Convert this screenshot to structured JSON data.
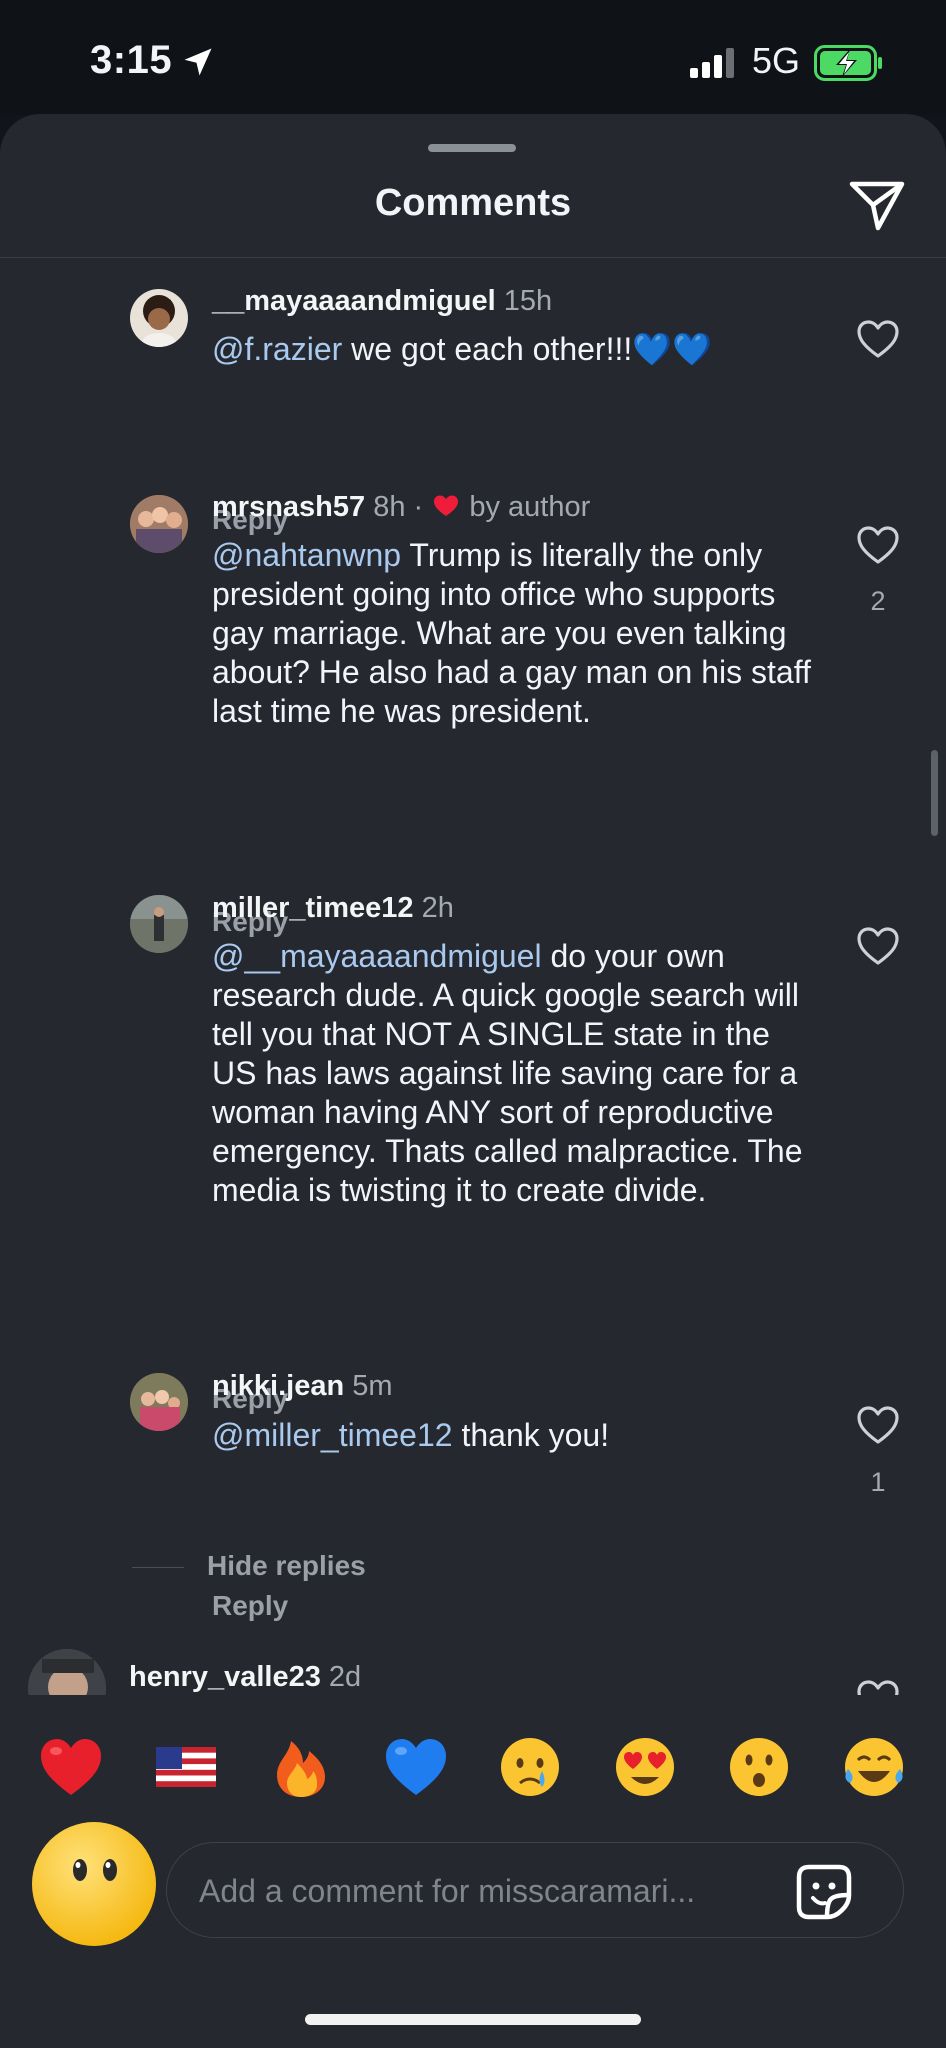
{
  "status_bar": {
    "time": "3:15",
    "network": "5G"
  },
  "header": {
    "title": "Comments"
  },
  "comments": [
    {
      "username": "__mayaaaandmiguel",
      "time": "15h",
      "mention": "@f.razier",
      "text": " we got each other!!!💙💙",
      "reply": "Reply"
    },
    {
      "username": "mrsnash57",
      "time": "8h",
      "separator": "·",
      "liked_by_author": "by author",
      "mention": "@nahtanwnp",
      "text": " Trump is literally the only president going into office who supports gay marriage. What are you even talking about? He also had a gay man on his staff last time he was president.",
      "reply": "Reply",
      "likes": "2"
    },
    {
      "username": "miller_timee12",
      "time": "2h",
      "mention": "@__mayaaaandmiguel",
      "text": " do your own research dude. A quick google search will tell you that NOT A SINGLE state in the US has laws against life saving care for a woman having ANY sort of reproductive emergency. Thats called malpractice. The media is twisting it to create divide.",
      "reply": "Reply"
    },
    {
      "username": "nikki.jean",
      "time": "5m",
      "mention": "@miller_timee12",
      "text": " thank you!",
      "reply": "Reply",
      "likes": "1"
    },
    {
      "username": "henry_valle23",
      "time": "2d"
    }
  ],
  "hide_replies": "Hide replies",
  "quick_reactions": [
    "❤️",
    "🇺🇸",
    "🔥",
    "💙",
    "😢",
    "😍",
    "😮",
    "😂"
  ],
  "composer": {
    "placeholder": "Add a comment for misscaramari..."
  }
}
